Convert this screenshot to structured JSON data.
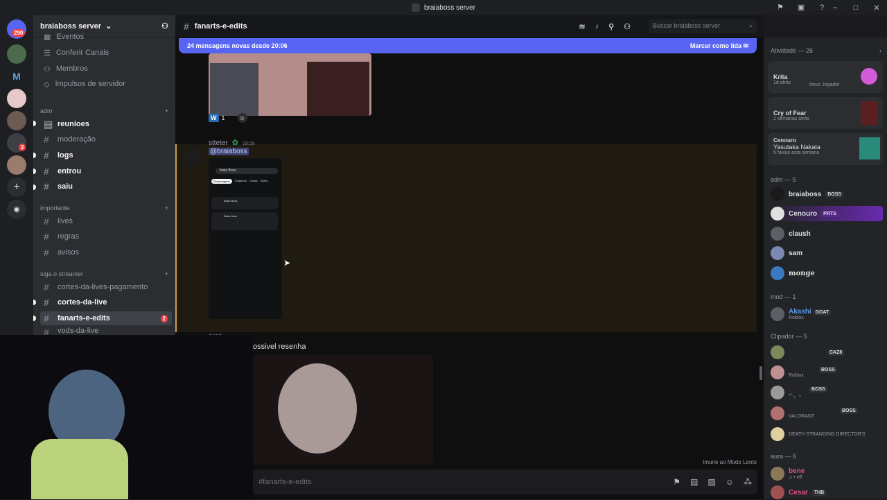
{
  "window": {
    "title": "braiaboss server"
  },
  "guilds": {
    "home_badge": "290",
    "badge2": "2",
    "m_letter": "M"
  },
  "server": {
    "name": "braiaboss server"
  },
  "sidebar": {
    "top_channels": [
      "Eventos",
      "Conferir Canais",
      "Membros",
      "Impulsos de servidor"
    ],
    "categories": [
      {
        "name": "adm",
        "channels": [
          "reunioes",
          "moderação",
          "logs",
          "entrou",
          "saiu"
        ]
      },
      {
        "name": "importante",
        "channels": [
          "lives",
          "regras",
          "avisos"
        ]
      },
      {
        "name": "siga o streamer",
        "channels": [
          "cortes-da-lives-pagamento",
          "cortes-da-live",
          "fanarts-e-edits",
          "vods-da-live"
        ]
      }
    ],
    "active_badge": "2"
  },
  "channel": {
    "name": "fanarts-e-edits",
    "hash": "#"
  },
  "newbar": {
    "text": "24 mensagens novas desde 20:06",
    "mark_read": "Marcar como lida"
  },
  "messages": {
    "reaction_letter": "W",
    "reaction_count": "1",
    "m2_author": "stteter",
    "m2_time": "19:28",
    "m2_mention": "@braiaboss",
    "m3_author_partial": "ouse",
    "m3_text": "ossivel resenha"
  },
  "phone": {
    "search": "braia Boss",
    "tabs": [
      "Personagens",
      "Criadores",
      "Cenas",
      "Vozes"
    ],
    "item1": "Braia Boss",
    "item2": "Braia boss"
  },
  "header": {
    "search_placeholder": "Buscar braiaboss server"
  },
  "members": {
    "activity_title": "Atividade — 26",
    "activities": [
      {
        "name": "Krita",
        "sub": "1d atrás",
        "sub2": "Novo Jogador"
      },
      {
        "name": "Cry of Fear",
        "sub": "2 semanas atrás"
      },
      {
        "name": "Cenouro",
        "title": "Yasutaka Nakata",
        "sub": "5 faixas esta semana"
      }
    ],
    "adm_header": "adm — 5",
    "adm": [
      {
        "name": "braiaboss",
        "tag": "BOSS"
      },
      {
        "name": "Cenouro",
        "tag": "PRTS"
      },
      {
        "name": "claush",
        "tag": ""
      },
      {
        "name": "sam",
        "tag": ""
      },
      {
        "name": "monge",
        "tag": ""
      }
    ],
    "mod_header": "mod — 1",
    "mod": [
      {
        "name": "Akashi",
        "tag": "GOAT",
        "sub": "Roblox"
      }
    ],
    "clip_header": "Clipador — 5",
    "clip": [
      {
        "tag": "CAZ8",
        "sub": ""
      },
      {
        "tag": "BOSS",
        "sub": "Roblox"
      },
      {
        "tag": "BOSS",
        "sub": "*˚‧。⋆"
      },
      {
        "tag": "BOSS",
        "sub": "VALORANT"
      },
      {
        "tag": "",
        "sub": "DEATH STRANDING DIRECTOR'S"
      }
    ],
    "aura_header": "aura — 6",
    "aura": [
      {
        "name": "bene",
        "sub": "♫ • off"
      },
      {
        "name": "Cesar",
        "tag": "THB"
      }
    ]
  },
  "input": {
    "placeholder": "#fanarts-e-edits",
    "slowmode": "Imune ao Modo Lento"
  }
}
